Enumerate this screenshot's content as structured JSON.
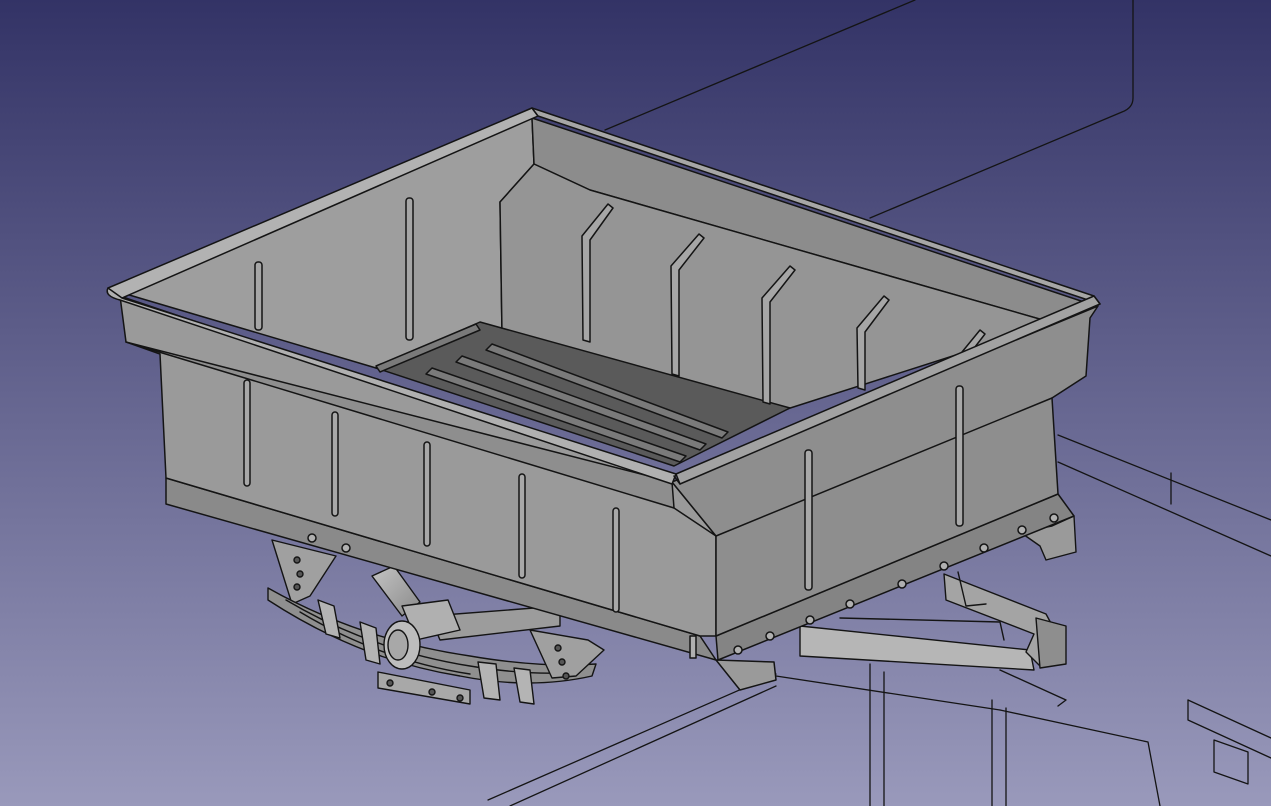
{
  "viewport": {
    "background_top": "#333366",
    "background_bottom": "#9999bb"
  },
  "model": {
    "body_light": "#9c9c9c",
    "body_mid": "#8c8c8c",
    "body_dark": "#7a7a7a",
    "floor_dark": "#5a5a5a",
    "floor_slat": "#777777",
    "rim": "#a8a8a8",
    "metal_light": "#b8b8b8",
    "metal_mid": "#9a9a9a",
    "edge": "#141414",
    "wireframe_edge": "#111111"
  }
}
